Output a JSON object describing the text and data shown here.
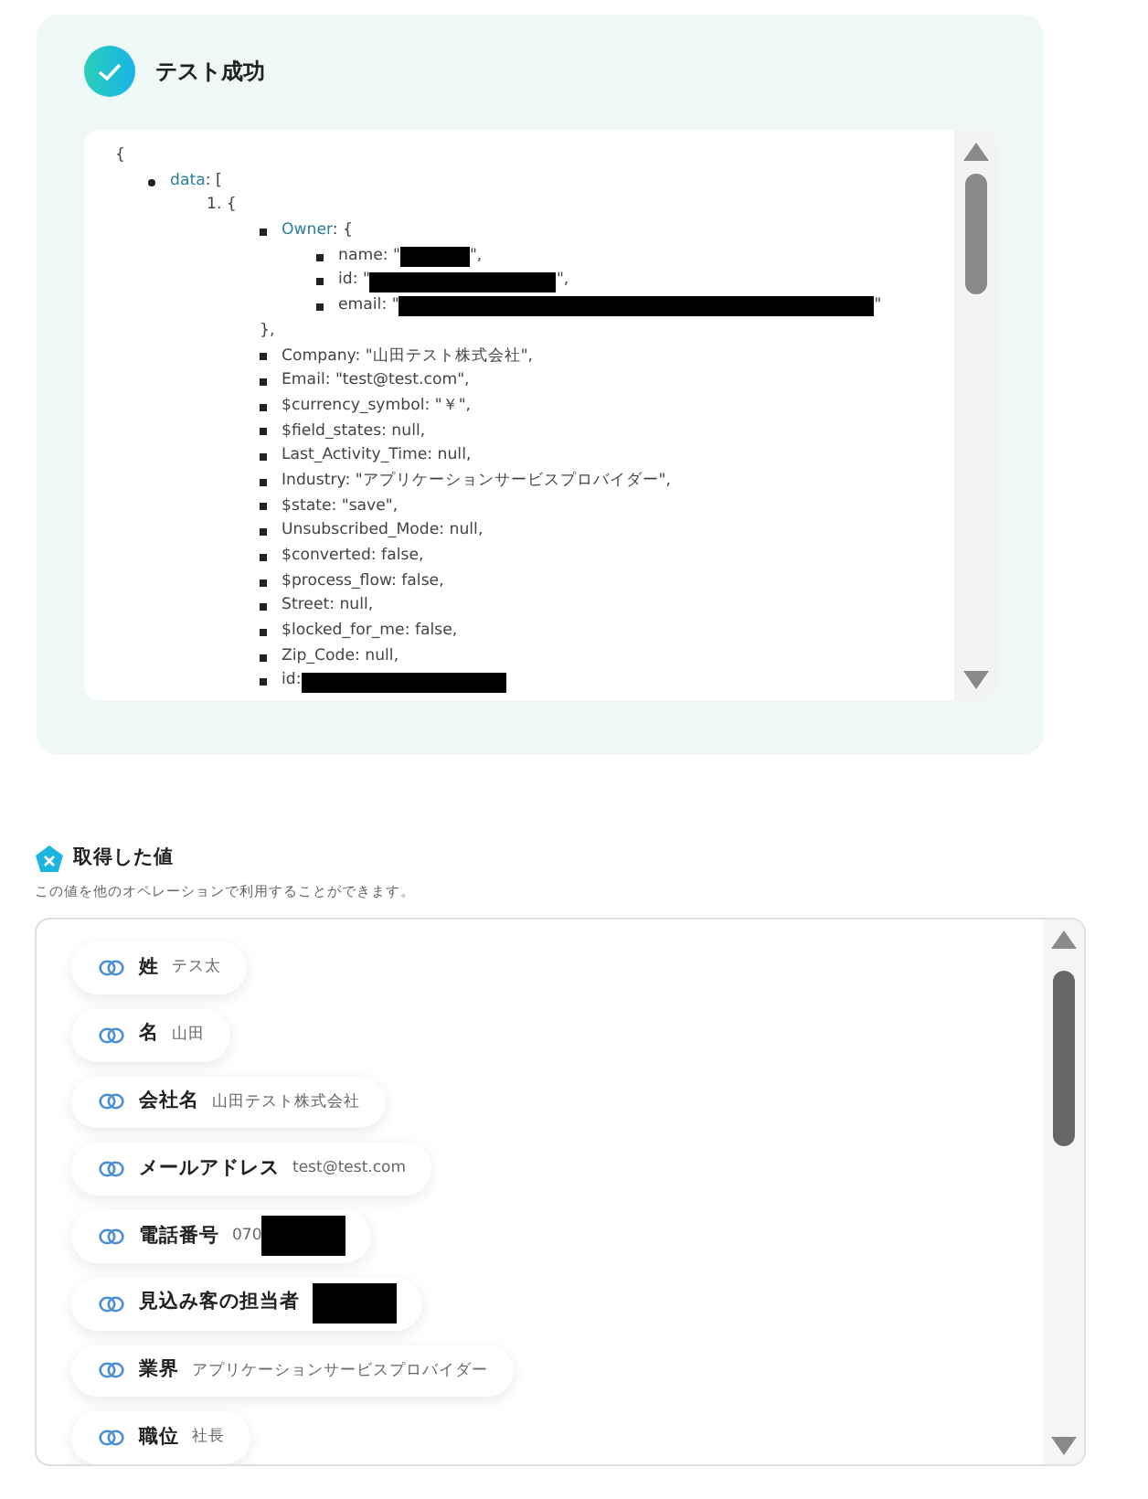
{
  "test_result": {
    "title": "テスト成功",
    "success": true,
    "json_tree": [
      {
        "kind": "plain",
        "text": "{",
        "children": [
          {
            "kind": "disc",
            "key": "data",
            "text": ": [",
            "children": [
              {
                "kind": "plain",
                "text": "1. {",
                "children": [
                  {
                    "kind": "square",
                    "key": "Owner",
                    "text": ": {",
                    "children": [
                      {
                        "kind": "square",
                        "text": "name: \"",
                        "redacted": true,
                        "suffix": "\","
                      },
                      {
                        "kind": "square",
                        "text": "id: \"",
                        "redacted": true,
                        "suffix": "\","
                      },
                      {
                        "kind": "square",
                        "text": "email: \"",
                        "redacted": true,
                        "suffix": "\""
                      }
                    ]
                  },
                  {
                    "kind": "plain",
                    "text": "},"
                  },
                  {
                    "kind": "square",
                    "text": "Company: \"山田テスト株式会社\","
                  },
                  {
                    "kind": "square",
                    "text": "Email: \"test@test.com\","
                  },
                  {
                    "kind": "square",
                    "text": "$currency_symbol: \"￥\","
                  },
                  {
                    "kind": "square",
                    "text": "$field_states: null,"
                  },
                  {
                    "kind": "square",
                    "text": "Last_Activity_Time: null,"
                  },
                  {
                    "kind": "square",
                    "text": "Industry: \"アプリケーションサービスプロバイダー\","
                  },
                  {
                    "kind": "square",
                    "text": "$state: \"save\","
                  },
                  {
                    "kind": "square",
                    "text": "Unsubscribed_Mode: null,"
                  },
                  {
                    "kind": "square",
                    "text": "$converted: false,"
                  },
                  {
                    "kind": "square",
                    "text": "$process_flow: false,"
                  },
                  {
                    "kind": "square",
                    "text": "Street: null,"
                  },
                  {
                    "kind": "square",
                    "text": "$locked_for_me: false,"
                  },
                  {
                    "kind": "square",
                    "text": "Zip_Code: null,"
                  },
                  {
                    "kind": "square",
                    "text": "id:",
                    "redacted": true
                  }
                ]
              }
            ]
          }
        ]
      }
    ]
  },
  "obtained_values": {
    "title": "取得した値",
    "description": "この値を他のオペレーションで利用することができます。",
    "items": [
      {
        "label": "姓",
        "value": "テス太"
      },
      {
        "label": "名",
        "value": "山田"
      },
      {
        "label": "会社名",
        "value": "山田テスト株式会社"
      },
      {
        "label": "メールアドレス",
        "value": "test@test.com"
      },
      {
        "label": "電話番号",
        "value": "070",
        "redacted": true
      },
      {
        "label": "見込み客の担当者",
        "redacted": true
      },
      {
        "label": "業界",
        "value": "アプリケーションサービスプロバイダー"
      },
      {
        "label": "職位",
        "value": "社長"
      }
    ]
  }
}
